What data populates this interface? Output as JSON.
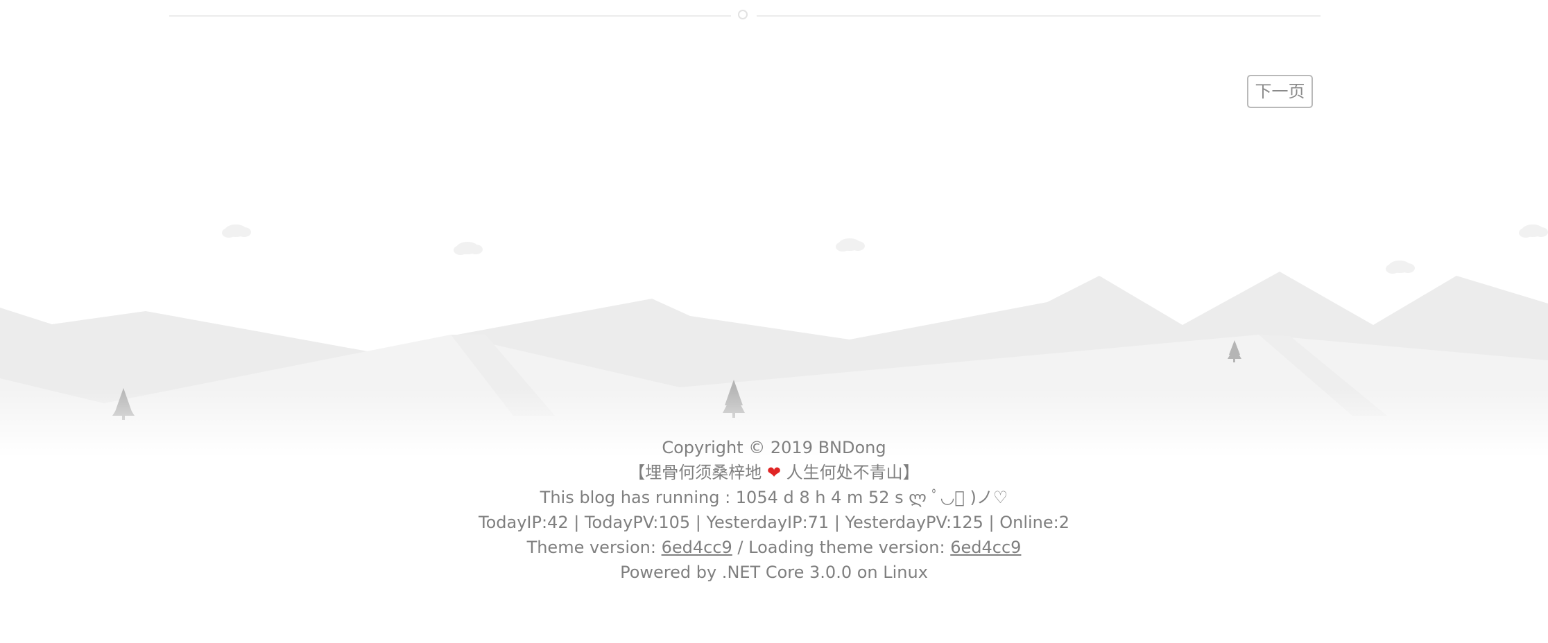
{
  "pagination": {
    "next_label": "下一页"
  },
  "footer": {
    "copyright": "Copyright © 2019 BNDong",
    "motto_open": "【埋骨何须桑梓地 ",
    "motto_heart": "❤",
    "motto_close": " 人生何处不青山】",
    "running": "This blog has running : 1054 d 8 h 4 m 52 s ლ ﾟ◡ﾟ )ノ♡",
    "stats": "TodayIP:42 | TodayPV:105 | YesterdayIP:71 | YesterdayPV:125 | Online:2",
    "theme_prefix": "Theme version: ",
    "theme_version": "6ed4cc9",
    "loading_prefix": " / Loading theme version: ",
    "loading_version": "6ed4cc9",
    "powered": "Powered by .NET Core 3.0.0 on Linux"
  },
  "colors": {
    "text": "#7f7f7f",
    "mountain_back": "#ececec",
    "mountain_front": "#f3f3f3",
    "tree": "#b5b5b5",
    "heart": "#e02424"
  }
}
